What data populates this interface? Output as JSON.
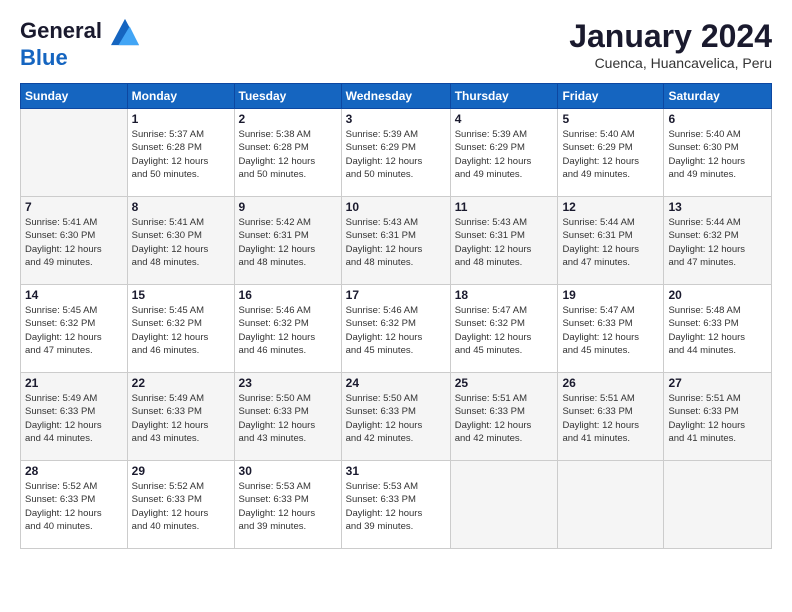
{
  "logo": {
    "line1": "General",
    "line2": "Blue"
  },
  "header": {
    "month": "January 2024",
    "location": "Cuenca, Huancavelica, Peru"
  },
  "weekdays": [
    "Sunday",
    "Monday",
    "Tuesday",
    "Wednesday",
    "Thursday",
    "Friday",
    "Saturday"
  ],
  "weeks": [
    [
      {
        "day": "",
        "sunrise": "",
        "sunset": "",
        "daylight": ""
      },
      {
        "day": "1",
        "sunrise": "Sunrise: 5:37 AM",
        "sunset": "Sunset: 6:28 PM",
        "daylight": "Daylight: 12 hours and 50 minutes."
      },
      {
        "day": "2",
        "sunrise": "Sunrise: 5:38 AM",
        "sunset": "Sunset: 6:28 PM",
        "daylight": "Daylight: 12 hours and 50 minutes."
      },
      {
        "day": "3",
        "sunrise": "Sunrise: 5:39 AM",
        "sunset": "Sunset: 6:29 PM",
        "daylight": "Daylight: 12 hours and 50 minutes."
      },
      {
        "day": "4",
        "sunrise": "Sunrise: 5:39 AM",
        "sunset": "Sunset: 6:29 PM",
        "daylight": "Daylight: 12 hours and 49 minutes."
      },
      {
        "day": "5",
        "sunrise": "Sunrise: 5:40 AM",
        "sunset": "Sunset: 6:29 PM",
        "daylight": "Daylight: 12 hours and 49 minutes."
      },
      {
        "day": "6",
        "sunrise": "Sunrise: 5:40 AM",
        "sunset": "Sunset: 6:30 PM",
        "daylight": "Daylight: 12 hours and 49 minutes."
      }
    ],
    [
      {
        "day": "7",
        "sunrise": "Sunrise: 5:41 AM",
        "sunset": "Sunset: 6:30 PM",
        "daylight": "Daylight: 12 hours and 49 minutes."
      },
      {
        "day": "8",
        "sunrise": "Sunrise: 5:41 AM",
        "sunset": "Sunset: 6:30 PM",
        "daylight": "Daylight: 12 hours and 48 minutes."
      },
      {
        "day": "9",
        "sunrise": "Sunrise: 5:42 AM",
        "sunset": "Sunset: 6:31 PM",
        "daylight": "Daylight: 12 hours and 48 minutes."
      },
      {
        "day": "10",
        "sunrise": "Sunrise: 5:43 AM",
        "sunset": "Sunset: 6:31 PM",
        "daylight": "Daylight: 12 hours and 48 minutes."
      },
      {
        "day": "11",
        "sunrise": "Sunrise: 5:43 AM",
        "sunset": "Sunset: 6:31 PM",
        "daylight": "Daylight: 12 hours and 48 minutes."
      },
      {
        "day": "12",
        "sunrise": "Sunrise: 5:44 AM",
        "sunset": "Sunset: 6:31 PM",
        "daylight": "Daylight: 12 hours and 47 minutes."
      },
      {
        "day": "13",
        "sunrise": "Sunrise: 5:44 AM",
        "sunset": "Sunset: 6:32 PM",
        "daylight": "Daylight: 12 hours and 47 minutes."
      }
    ],
    [
      {
        "day": "14",
        "sunrise": "Sunrise: 5:45 AM",
        "sunset": "Sunset: 6:32 PM",
        "daylight": "Daylight: 12 hours and 47 minutes."
      },
      {
        "day": "15",
        "sunrise": "Sunrise: 5:45 AM",
        "sunset": "Sunset: 6:32 PM",
        "daylight": "Daylight: 12 hours and 46 minutes."
      },
      {
        "day": "16",
        "sunrise": "Sunrise: 5:46 AM",
        "sunset": "Sunset: 6:32 PM",
        "daylight": "Daylight: 12 hours and 46 minutes."
      },
      {
        "day": "17",
        "sunrise": "Sunrise: 5:46 AM",
        "sunset": "Sunset: 6:32 PM",
        "daylight": "Daylight: 12 hours and 45 minutes."
      },
      {
        "day": "18",
        "sunrise": "Sunrise: 5:47 AM",
        "sunset": "Sunset: 6:32 PM",
        "daylight": "Daylight: 12 hours and 45 minutes."
      },
      {
        "day": "19",
        "sunrise": "Sunrise: 5:47 AM",
        "sunset": "Sunset: 6:33 PM",
        "daylight": "Daylight: 12 hours and 45 minutes."
      },
      {
        "day": "20",
        "sunrise": "Sunrise: 5:48 AM",
        "sunset": "Sunset: 6:33 PM",
        "daylight": "Daylight: 12 hours and 44 minutes."
      }
    ],
    [
      {
        "day": "21",
        "sunrise": "Sunrise: 5:49 AM",
        "sunset": "Sunset: 6:33 PM",
        "daylight": "Daylight: 12 hours and 44 minutes."
      },
      {
        "day": "22",
        "sunrise": "Sunrise: 5:49 AM",
        "sunset": "Sunset: 6:33 PM",
        "daylight": "Daylight: 12 hours and 43 minutes."
      },
      {
        "day": "23",
        "sunrise": "Sunrise: 5:50 AM",
        "sunset": "Sunset: 6:33 PM",
        "daylight": "Daylight: 12 hours and 43 minutes."
      },
      {
        "day": "24",
        "sunrise": "Sunrise: 5:50 AM",
        "sunset": "Sunset: 6:33 PM",
        "daylight": "Daylight: 12 hours and 42 minutes."
      },
      {
        "day": "25",
        "sunrise": "Sunrise: 5:51 AM",
        "sunset": "Sunset: 6:33 PM",
        "daylight": "Daylight: 12 hours and 42 minutes."
      },
      {
        "day": "26",
        "sunrise": "Sunrise: 5:51 AM",
        "sunset": "Sunset: 6:33 PM",
        "daylight": "Daylight: 12 hours and 41 minutes."
      },
      {
        "day": "27",
        "sunrise": "Sunrise: 5:51 AM",
        "sunset": "Sunset: 6:33 PM",
        "daylight": "Daylight: 12 hours and 41 minutes."
      }
    ],
    [
      {
        "day": "28",
        "sunrise": "Sunrise: 5:52 AM",
        "sunset": "Sunset: 6:33 PM",
        "daylight": "Daylight: 12 hours and 40 minutes."
      },
      {
        "day": "29",
        "sunrise": "Sunrise: 5:52 AM",
        "sunset": "Sunset: 6:33 PM",
        "daylight": "Daylight: 12 hours and 40 minutes."
      },
      {
        "day": "30",
        "sunrise": "Sunrise: 5:53 AM",
        "sunset": "Sunset: 6:33 PM",
        "daylight": "Daylight: 12 hours and 39 minutes."
      },
      {
        "day": "31",
        "sunrise": "Sunrise: 5:53 AM",
        "sunset": "Sunset: 6:33 PM",
        "daylight": "Daylight: 12 hours and 39 minutes."
      },
      {
        "day": "",
        "sunrise": "",
        "sunset": "",
        "daylight": ""
      },
      {
        "day": "",
        "sunrise": "",
        "sunset": "",
        "daylight": ""
      },
      {
        "day": "",
        "sunrise": "",
        "sunset": "",
        "daylight": ""
      }
    ]
  ]
}
